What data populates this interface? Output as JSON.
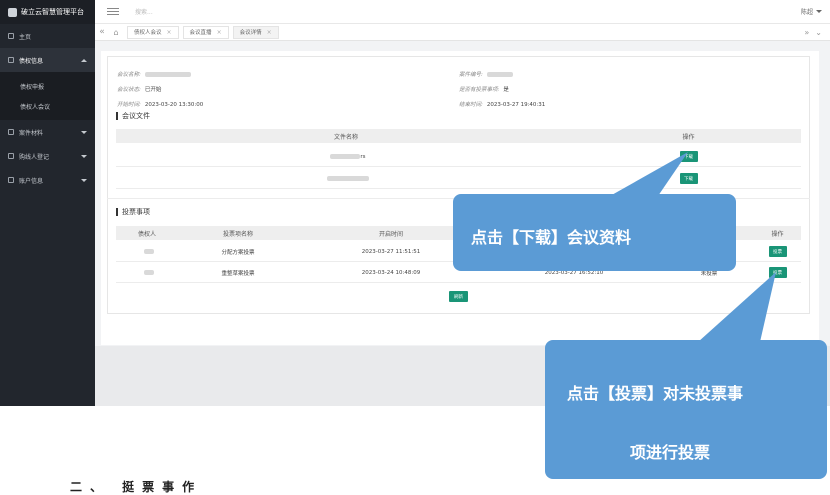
{
  "app": {
    "title": "破立云智慧管理平台"
  },
  "sidebar": {
    "items": [
      {
        "label": "主页"
      },
      {
        "label": "债权信息"
      },
      {
        "label": "案件材料"
      },
      {
        "label": "购线人登记"
      },
      {
        "label": "账户信息"
      }
    ],
    "subitems": [
      {
        "label": "债权申报"
      },
      {
        "label": "债权人会议"
      }
    ]
  },
  "topbar": {
    "search_placeholder": "搜索...",
    "user_name": "陈超"
  },
  "tabs": [
    {
      "label": "债权人会议"
    },
    {
      "label": "会议直播"
    },
    {
      "label": "会议详情"
    }
  ],
  "meeting": {
    "name_label": "会议名称:",
    "case_no_label": "案件编号:",
    "status_label": "会议状态:",
    "status_value": "已开始",
    "has_vote_label": "是否有投票事项:",
    "has_vote_value": "是",
    "start_label": "开始时间:",
    "start_value": "2023-03-20 13:30:00",
    "end_label": "结束时间:",
    "end_value": "2023-03-27 19:40:31"
  },
  "files": {
    "section_title": "会议文件",
    "columns": [
      "文件名称",
      "操作"
    ],
    "rows": [
      {
        "name_suffix": "rs",
        "action": "下载"
      },
      {
        "name_suffix": "",
        "action": "下载"
      }
    ]
  },
  "votes": {
    "section_title": "投票事项",
    "columns": [
      "债权人",
      "投票项名称",
      "开启时间",
      "操作"
    ],
    "rows": [
      {
        "item": "分配方案投票",
        "start": "2023-03-27 11:51:51",
        "end": "",
        "status": "",
        "action": "投票"
      },
      {
        "item": "重整草案投票",
        "start": "2023-03-24 10:48:09",
        "end": "2023-03-27 16:52:10",
        "status": "未投票",
        "action": "投票"
      }
    ],
    "refresh_label": "刷新"
  },
  "callouts": {
    "download": "点击【下载】会议资料",
    "vote_line1": "点击【投票】对未投票事",
    "vote_line2": "项进行投票",
    "bottom_fragment": "二、 挺票事作"
  }
}
